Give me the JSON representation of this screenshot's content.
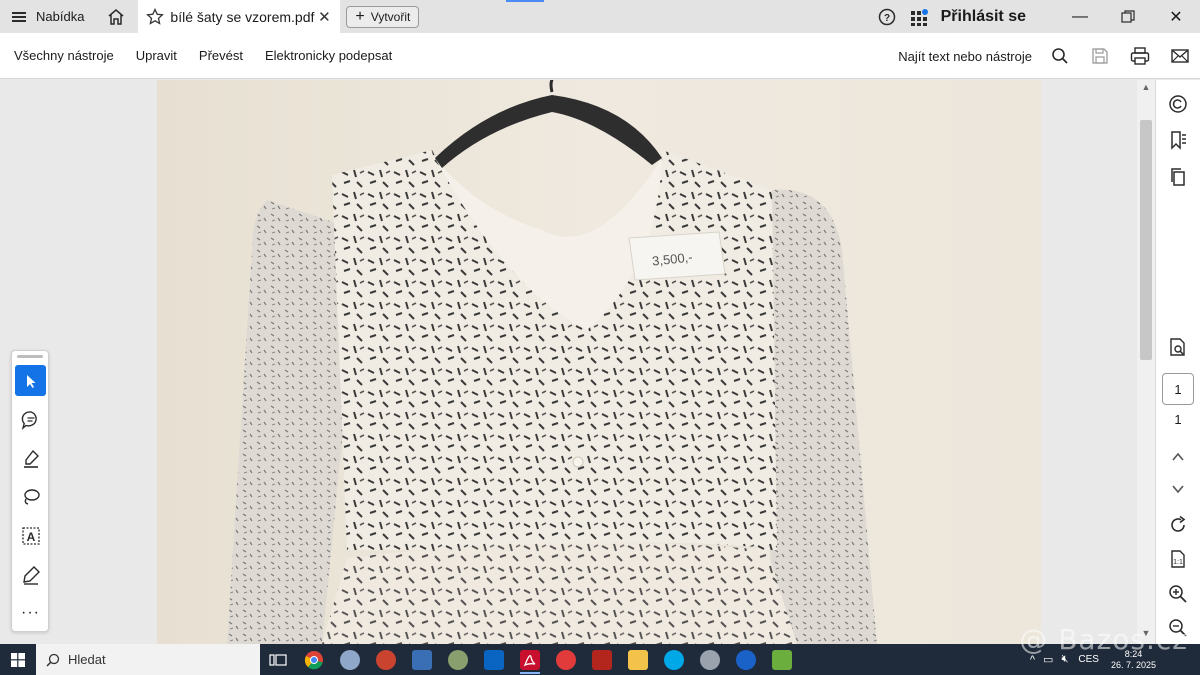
{
  "titlebar": {
    "menu_label": "Nabídka",
    "tab_title": "bílé šaty se vzorem.pdf",
    "create_label": "Vytvořit",
    "signin_label": "Přihlásit se"
  },
  "toolbar": {
    "items": [
      "Všechny nástroje",
      "Upravit",
      "Převést",
      "Elektronicky podepsat"
    ],
    "find_label": "Najít text nebo nástroje"
  },
  "pager": {
    "current": "1",
    "total": "1"
  },
  "document": {
    "tag_text": "3,500,-"
  },
  "taskbar": {
    "search_placeholder": "Hledat",
    "language": "CES",
    "time": "8:24",
    "date": "26. 7. 2025"
  },
  "watermark": "@ Bazos.cz",
  "colors": {
    "accent": "#1473e6",
    "taskbar": "#1f2a3a",
    "page_bg": "#ede8de"
  }
}
